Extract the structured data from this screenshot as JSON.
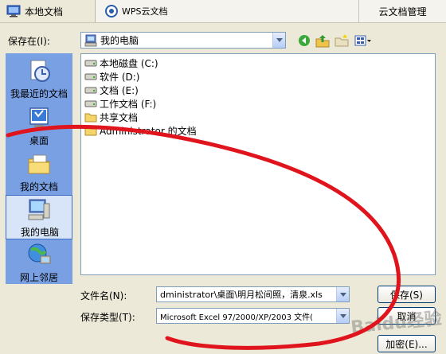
{
  "tabs": [
    {
      "label": "本地文档",
      "icon": "monitor-icon"
    },
    {
      "label": "WPS云文档",
      "icon": "wps-cloud-icon"
    },
    {
      "label": "云文档管理"
    }
  ],
  "save_in": {
    "label": "保存在(I):",
    "value": "我的电脑"
  },
  "places": [
    {
      "label": "我最近的文档",
      "icon": "recent-documents-icon"
    },
    {
      "label": "桌面",
      "icon": "desktop-icon"
    },
    {
      "label": "我的文档",
      "icon": "my-documents-icon"
    },
    {
      "label": "我的电脑",
      "icon": "my-computer-icon"
    },
    {
      "label": "网上邻居",
      "icon": "network-places-icon"
    }
  ],
  "files": [
    {
      "name": "本地磁盘 (C:)",
      "icon": "drive-icon"
    },
    {
      "name": "软件 (D:)",
      "icon": "drive-icon"
    },
    {
      "name": "文档 (E:)",
      "icon": "drive-icon"
    },
    {
      "name": "工作文档 (F:)",
      "icon": "drive-icon"
    },
    {
      "name": "共享文档",
      "icon": "folder-icon"
    },
    {
      "name": "Administrator 的文档",
      "icon": "folder-icon"
    }
  ],
  "filename": {
    "label": "文件名(N):",
    "value": "dministrator\\桌面\\明月松间照，清泉.xls"
  },
  "filetype": {
    "label": "保存类型(T):",
    "value": "Microsoft Excel 97/2000/XP/2003 文件("
  },
  "buttons": {
    "save": "保存(S)",
    "cancel": "取消",
    "encrypt": "加密(E)..."
  },
  "watermark": "Baidu经验",
  "colors": {
    "annotation": "#e0141c",
    "dialog_bg": "#ece9d8",
    "border": "#7f9db9"
  }
}
